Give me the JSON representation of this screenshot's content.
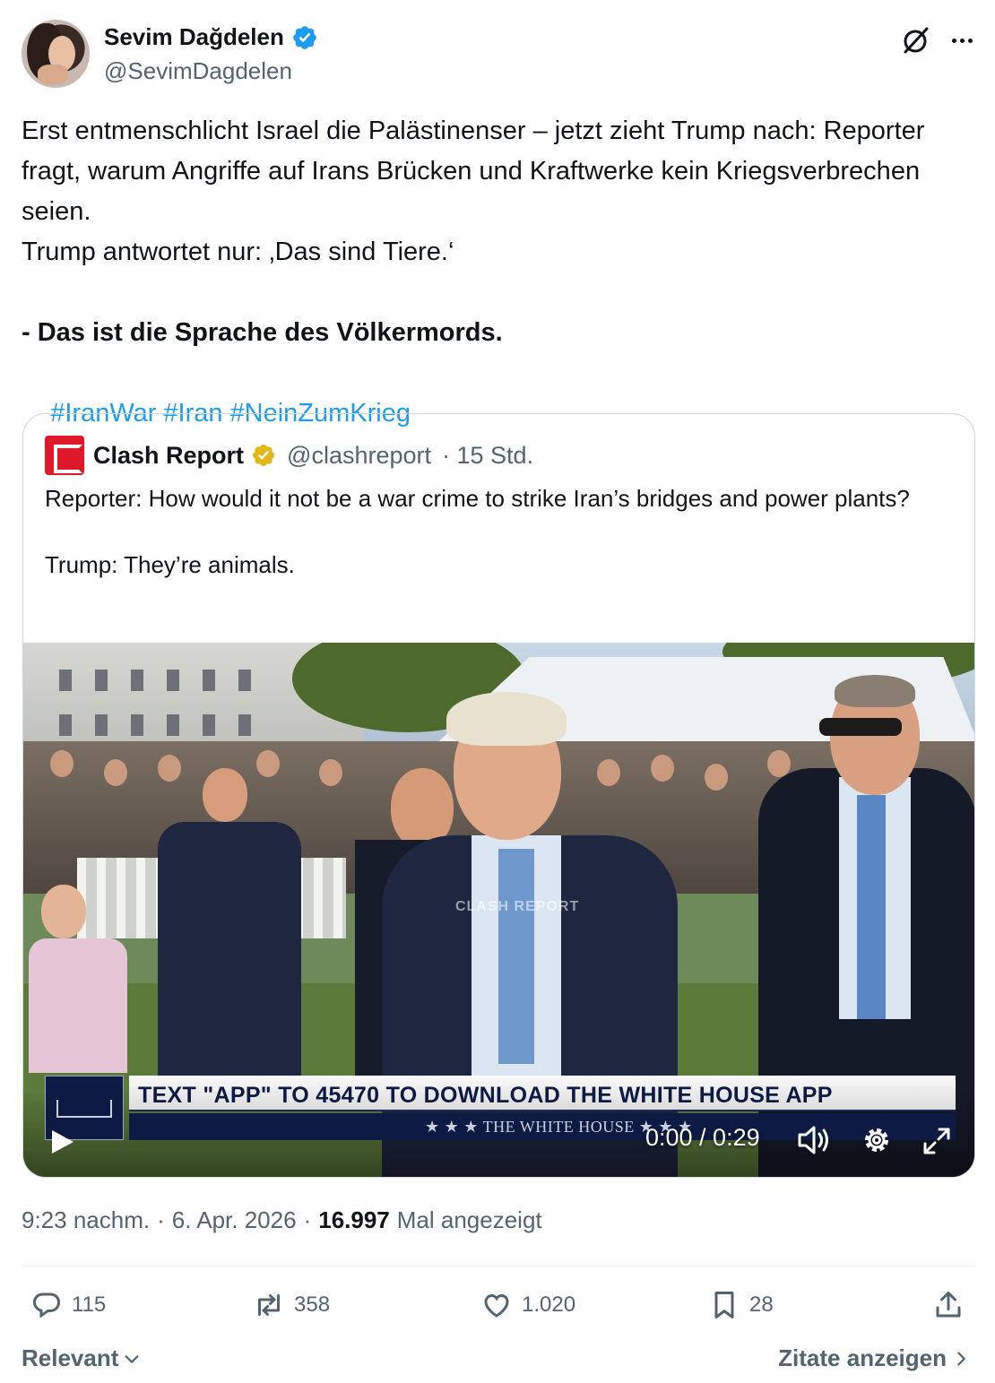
{
  "author": {
    "name": "Sevim Dağdelen",
    "handle": "@SevimDagdelen"
  },
  "post": {
    "paragraph1": "Erst entmenschlicht Israel die Palästinenser – jetzt zieht Trump nach: Reporter fragt, warum Angriffe auf Irans Brücken und Kraftwerke kein Kriegsverbrechen seien.",
    "paragraph2": "Trump antwortet nur: ‚Das sind Tiere.‘",
    "bold_line": "- Das ist die Sprache des Völkermords.",
    "hashtags": [
      "#IranWar",
      "#Iran",
      "#NeinZumKrieg"
    ]
  },
  "quote": {
    "name": "Clash Report",
    "handle": "@clashreport",
    "time": "· 15 Std.",
    "line1": "Reporter: How would it not be a war crime to strike Iran’s bridges and power plants?",
    "line2": "Trump: They’re animals.",
    "video": {
      "chyron": "TEXT \"APP\" TO 45470 TO DOWNLOAD THE WHITE HOUSE APP",
      "chyron_sub": "★ ★ ★   THE WHITE HOUSE   ★ ★ ★",
      "watermark": "CLASH REPORT",
      "time": "0:00 / 0:29"
    }
  },
  "meta": {
    "time": "9:23 nachm.",
    "sep1": "·",
    "date": "6. Apr. 2026",
    "sep2": "·",
    "views": "16.997",
    "views_label": "Mal angezeigt"
  },
  "actions": {
    "replies": "115",
    "retweets": "358",
    "likes": "1.020",
    "bookmarks": "28"
  },
  "footer": {
    "sort": "Relevant",
    "quotes": "Zitate anzeigen"
  },
  "colors": {
    "link": "#1d9bf0",
    "verified_blue": "#1d9bf0",
    "verified_gold": "#e2b719",
    "secondary_text": "#536471"
  }
}
